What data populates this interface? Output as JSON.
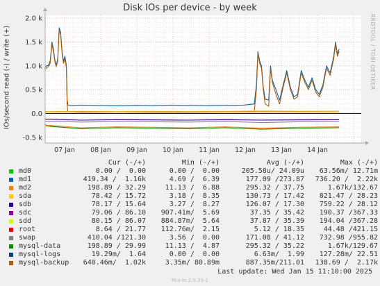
{
  "title": "Disk IOs per device - by week",
  "ylabel": "IOs/second read (-) / write (+)",
  "watermark": "RRDTOOL / TOBI OETIKER",
  "footer": "Munin 2.0.33-1",
  "last_update": "Last update: Wed Jan 15 11:10:00 2025",
  "legend_header": {
    "cur": "Cur (-/+)",
    "min": "Min (-/+)",
    "avg": "Avg (-/+)",
    "max": "Max (-/+)"
  },
  "legend": [
    {
      "name": "md0",
      "color": "#00cc00",
      "cur": "0.00 /  0.00",
      "min": "0.00 /  0.00",
      "avg": "205.58u/ 24.09u",
      "max": "63.56m/ 12.71m"
    },
    {
      "name": "md1",
      "color": "#0066b3",
      "cur": "419.34 /  1.16k",
      "min": "4.69 /  6.39",
      "avg": "177.09 /273.87",
      "max": "736.20 /  2.22k"
    },
    {
      "name": "md2",
      "color": "#ff8000",
      "cur": "198.89 / 32.29",
      "min": "11.13 /  6.88",
      "avg": "295.32 / 37.75",
      "max": "1.67k/132.67"
    },
    {
      "name": "sda",
      "color": "#ffcc00",
      "cur": "78.42 / 15.72",
      "min": "3.18 /  8.35",
      "avg": "130.73 / 17.42",
      "max": "821.47 / 28.23"
    },
    {
      "name": "sdb",
      "color": "#330099",
      "cur": "78.17 / 15.64",
      "min": "3.27 /  8.27",
      "avg": "126.07 / 17.30",
      "max": "759.22 / 28.12"
    },
    {
      "name": "sdc",
      "color": "#990099",
      "cur": "79.06 / 86.10",
      "min": "907.41m/  5.69",
      "avg": "37.35 / 35.42",
      "max": "190.37 /367.33"
    },
    {
      "name": "sdd",
      "color": "#ccff00",
      "cur": "80.15 / 86.07",
      "min": "884.87m/  5.64",
      "avg": "37.87 / 35.39",
      "max": "194.04 /367.28"
    },
    {
      "name": "root",
      "color": "#ff0000",
      "cur": "8.64 / 21.77",
      "min": "112.76m/  2.15",
      "avg": "5.12 / 18.35",
      "max": "44.48 /421.15"
    },
    {
      "name": "swap",
      "color": "#808080",
      "cur": "410.04 /121.30",
      "min": "3.56 /  0.00",
      "avg": "171.08 / 41.12",
      "max": "732.98 /955.82"
    },
    {
      "name": "mysql-data",
      "color": "#008f00",
      "cur": "198.89 / 29.99",
      "min": "11.13 /  4.87",
      "avg": "295.32 / 35.22",
      "max": "1.67k/129.67"
    },
    {
      "name": "mysql-logs",
      "color": "#00487d",
      "cur": "19.29m/  1.64",
      "min": "0.00 /  0.00",
      "avg": "6.63m/  1.99",
      "max": "127.28m/ 22.51"
    },
    {
      "name": "mysql-backup",
      "color": "#b35a00",
      "cur": "640.46m/  1.02k",
      "min": "3.35m/ 80.89m",
      "avg": "887.35m/211.01",
      "max": "138.69 /  2.17k"
    }
  ],
  "chart_data": {
    "type": "line",
    "title": "Disk IOs per device - by week",
    "ylabel": "IOs/second read (-) / write (+)",
    "x_ticks": [
      "07 Jan",
      "08 Jan",
      "09 Jan",
      "10 Jan",
      "11 Jan",
      "12 Jan",
      "13 Jan",
      "14 Jan"
    ],
    "y_ticks": [
      "2.0 k",
      "1.5 k",
      "1.0 k",
      "0.5 k",
      "0.0",
      "-0.5 k"
    ],
    "ylim": [
      -620,
      2060
    ],
    "grid": true,
    "series": [
      {
        "name": "md1 (write)",
        "color": "#0066b3",
        "points": [
          [
            0.0,
            960
          ],
          [
            0.05,
            1000
          ],
          [
            0.1,
            1010
          ],
          [
            0.15,
            1100
          ],
          [
            0.2,
            1500
          ],
          [
            0.24,
            1350
          ],
          [
            0.28,
            1120
          ],
          [
            0.32,
            1000
          ],
          [
            0.36,
            1150
          ],
          [
            0.4,
            1800
          ],
          [
            0.44,
            1700
          ],
          [
            0.48,
            1300
          ],
          [
            0.52,
            1100
          ],
          [
            0.56,
            1200
          ],
          [
            0.6,
            1000
          ],
          [
            0.62,
            300
          ],
          [
            0.64,
            180
          ],
          [
            0.7,
            170
          ],
          [
            1.0,
            175
          ],
          [
            1.5,
            170
          ],
          [
            2.0,
            160
          ],
          [
            2.5,
            170
          ],
          [
            3.0,
            165
          ],
          [
            3.5,
            175
          ],
          [
            4.0,
            170
          ],
          [
            4.5,
            165
          ],
          [
            5.0,
            170
          ],
          [
            5.5,
            175
          ],
          [
            5.8,
            200
          ],
          [
            5.86,
            600
          ],
          [
            5.9,
            1300
          ],
          [
            5.95,
            1100
          ],
          [
            6.0,
            1000
          ],
          [
            6.05,
            550
          ],
          [
            6.1,
            300
          ],
          [
            6.2,
            280
          ],
          [
            6.25,
            1000
          ],
          [
            6.3,
            700
          ],
          [
            6.4,
            500
          ],
          [
            6.5,
            280
          ],
          [
            6.6,
            600
          ],
          [
            6.7,
            900
          ],
          [
            6.8,
            550
          ],
          [
            6.9,
            350
          ],
          [
            7.0,
            400
          ],
          [
            7.1,
            900
          ],
          [
            7.2,
            700
          ],
          [
            7.3,
            550
          ],
          [
            7.4,
            750
          ],
          [
            7.5,
            500
          ],
          [
            7.6,
            400
          ],
          [
            7.7,
            600
          ],
          [
            7.8,
            1000
          ],
          [
            7.9,
            850
          ],
          [
            8.0,
            1200
          ],
          [
            8.05,
            1500
          ],
          [
            8.1,
            1250
          ],
          [
            8.15,
            1350
          ]
        ]
      },
      {
        "name": "mysql-backup (write)",
        "color": "#b35a00",
        "points": [
          [
            0.0,
            920
          ],
          [
            0.05,
            960
          ],
          [
            0.1,
            980
          ],
          [
            0.15,
            1050
          ],
          [
            0.2,
            1450
          ],
          [
            0.24,
            1300
          ],
          [
            0.28,
            1080
          ],
          [
            0.32,
            980
          ],
          [
            0.36,
            1100
          ],
          [
            0.4,
            1750
          ],
          [
            0.44,
            1650
          ],
          [
            0.48,
            1250
          ],
          [
            0.52,
            1050
          ],
          [
            0.56,
            1150
          ],
          [
            0.6,
            950
          ],
          [
            0.62,
            200
          ],
          [
            0.64,
            40
          ],
          [
            1.0,
            30
          ],
          [
            2.0,
            35
          ],
          [
            3.0,
            30
          ],
          [
            4.0,
            30
          ],
          [
            5.0,
            35
          ],
          [
            5.8,
            40
          ],
          [
            5.86,
            500
          ],
          [
            5.9,
            1250
          ],
          [
            5.95,
            1050
          ],
          [
            6.0,
            950
          ],
          [
            6.05,
            500
          ],
          [
            6.1,
            200
          ],
          [
            6.2,
            150
          ],
          [
            6.25,
            950
          ],
          [
            6.3,
            650
          ],
          [
            6.4,
            400
          ],
          [
            6.5,
            200
          ],
          [
            6.6,
            550
          ],
          [
            6.7,
            850
          ],
          [
            6.8,
            500
          ],
          [
            6.9,
            300
          ],
          [
            7.0,
            350
          ],
          [
            7.1,
            850
          ],
          [
            7.2,
            650
          ],
          [
            7.3,
            500
          ],
          [
            7.4,
            700
          ],
          [
            7.5,
            450
          ],
          [
            7.6,
            350
          ],
          [
            7.7,
            550
          ],
          [
            7.8,
            950
          ],
          [
            7.9,
            800
          ],
          [
            8.0,
            1150
          ],
          [
            8.05,
            1450
          ],
          [
            8.1,
            1200
          ],
          [
            8.15,
            1300
          ]
        ]
      },
      {
        "name": "sdc/sdd (write)",
        "color": "#ccff00",
        "points": [
          [
            0.0,
            40
          ],
          [
            1.0,
            45
          ],
          [
            2.0,
            40
          ],
          [
            3.0,
            45
          ],
          [
            4.0,
            40
          ],
          [
            5.0,
            45
          ],
          [
            6.0,
            60
          ],
          [
            7.0,
            50
          ],
          [
            8.15,
            55
          ]
        ]
      },
      {
        "name": "md2 (write)",
        "color": "#ff8000",
        "points": [
          [
            0.0,
            35
          ],
          [
            1.0,
            38
          ],
          [
            2.0,
            36
          ],
          [
            3.0,
            37
          ],
          [
            4.0,
            35
          ],
          [
            5.0,
            38
          ],
          [
            6.0,
            40
          ],
          [
            7.0,
            38
          ],
          [
            8.15,
            36
          ]
        ]
      },
      {
        "name": "md2 (read)",
        "color": "#ff8000",
        "points": [
          [
            0.0,
            -240
          ],
          [
            1.0,
            -300
          ],
          [
            2.0,
            -280
          ],
          [
            3.0,
            -290
          ],
          [
            4.0,
            -300
          ],
          [
            5.0,
            -280
          ],
          [
            6.0,
            -310
          ],
          [
            7.0,
            -290
          ],
          [
            8.15,
            -280
          ]
        ]
      },
      {
        "name": "mysql-data (read)",
        "color": "#008f00",
        "points": [
          [
            0.0,
            -260
          ],
          [
            1.0,
            -320
          ],
          [
            2.0,
            -300
          ],
          [
            3.0,
            -310
          ],
          [
            4.0,
            -320
          ],
          [
            5.0,
            -300
          ],
          [
            6.0,
            -330
          ],
          [
            7.0,
            -310
          ],
          [
            8.15,
            -300
          ]
        ]
      },
      {
        "name": "sdb (read)",
        "color": "#330099",
        "points": [
          [
            0.0,
            -120
          ],
          [
            1.0,
            -140
          ],
          [
            2.0,
            -130
          ],
          [
            3.0,
            -135
          ],
          [
            4.0,
            -140
          ],
          [
            5.0,
            -130
          ],
          [
            6.0,
            -140
          ],
          [
            7.0,
            -135
          ],
          [
            8.15,
            -130
          ]
        ]
      },
      {
        "name": "swap (read)",
        "color": "#808080",
        "points": [
          [
            0.0,
            -160
          ],
          [
            1.0,
            -180
          ],
          [
            2.0,
            -170
          ],
          [
            3.0,
            -175
          ],
          [
            4.0,
            -180
          ],
          [
            5.0,
            -170
          ],
          [
            6.0,
            -190
          ],
          [
            7.0,
            -175
          ],
          [
            8.15,
            -170
          ]
        ]
      }
    ]
  }
}
